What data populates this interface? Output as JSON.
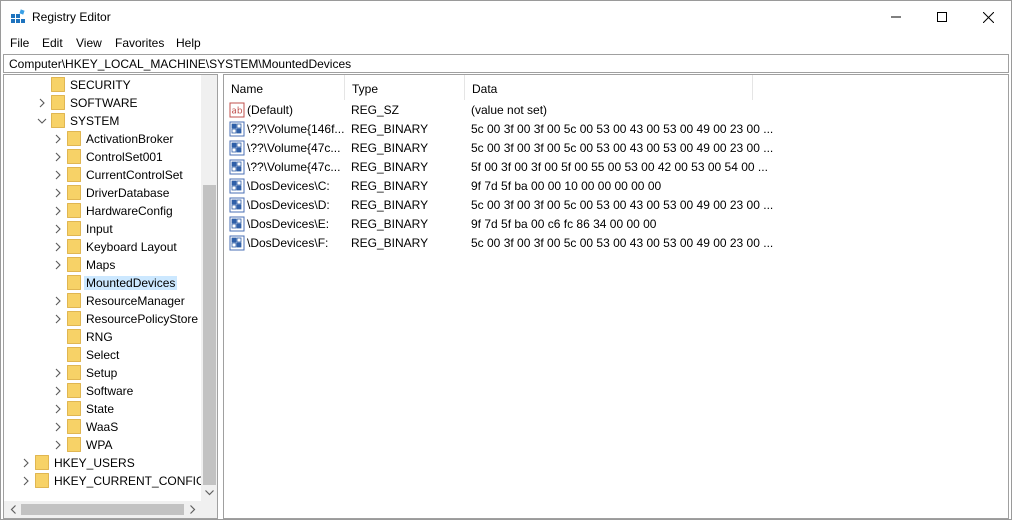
{
  "window": {
    "title": "Registry Editor",
    "controls": {
      "minimize": "minimize",
      "maximize": "maximize",
      "close": "close"
    }
  },
  "menu": [
    "File",
    "Edit",
    "View",
    "Favorites",
    "Help"
  ],
  "address": "Computer\\HKEY_LOCAL_MACHINE\\SYSTEM\\MountedDevices",
  "tree": [
    {
      "label": "SECURITY",
      "has_chevron": false,
      "chevron": "",
      "selected": false
    },
    {
      "label": "SOFTWARE",
      "has_chevron": true,
      "chevron": "right",
      "selected": false
    },
    {
      "label": "SYSTEM",
      "has_chevron": true,
      "chevron": "down",
      "selected": false
    },
    {
      "label": "ActivationBroker",
      "has_chevron": true,
      "chevron": "right",
      "selected": false
    },
    {
      "label": "ControlSet001",
      "has_chevron": true,
      "chevron": "right",
      "selected": false
    },
    {
      "label": "CurrentControlSet",
      "has_chevron": true,
      "chevron": "right",
      "selected": false
    },
    {
      "label": "DriverDatabase",
      "has_chevron": true,
      "chevron": "right",
      "selected": false
    },
    {
      "label": "HardwareConfig",
      "has_chevron": true,
      "chevron": "right",
      "selected": false
    },
    {
      "label": "Input",
      "has_chevron": true,
      "chevron": "right",
      "selected": false
    },
    {
      "label": "Keyboard Layout",
      "has_chevron": true,
      "chevron": "right",
      "selected": false
    },
    {
      "label": "Maps",
      "has_chevron": true,
      "chevron": "right",
      "selected": false
    },
    {
      "label": "MountedDevices",
      "has_chevron": false,
      "chevron": "",
      "selected": true
    },
    {
      "label": "ResourceManager",
      "has_chevron": true,
      "chevron": "right",
      "selected": false
    },
    {
      "label": "ResourcePolicyStore",
      "has_chevron": true,
      "chevron": "right",
      "selected": false
    },
    {
      "label": "RNG",
      "has_chevron": false,
      "chevron": "",
      "selected": false
    },
    {
      "label": "Select",
      "has_chevron": false,
      "chevron": "",
      "selected": false
    },
    {
      "label": "Setup",
      "has_chevron": true,
      "chevron": "right",
      "selected": false
    },
    {
      "label": "Software",
      "has_chevron": true,
      "chevron": "right",
      "selected": false
    },
    {
      "label": "State",
      "has_chevron": true,
      "chevron": "right",
      "selected": false
    },
    {
      "label": "WaaS",
      "has_chevron": true,
      "chevron": "right",
      "selected": false
    },
    {
      "label": "WPA",
      "has_chevron": true,
      "chevron": "right",
      "selected": false
    },
    {
      "label": "HKEY_USERS",
      "has_chevron": true,
      "chevron": "right",
      "selected": false
    },
    {
      "label": "HKEY_CURRENT_CONFIG",
      "has_chevron": true,
      "chevron": "right",
      "selected": false
    }
  ],
  "columns": [
    "Name",
    "Type",
    "Data"
  ],
  "values": [
    {
      "icon": "string-value-icon",
      "name": "(Default)",
      "type": "REG_SZ",
      "data": "(value not set)"
    },
    {
      "icon": "binary-value-icon",
      "name": "\\??\\Volume{146f...",
      "type": "REG_BINARY",
      "data": "5c 00 3f 00 3f 00 5c 00 53 00 43 00 53 00 49 00 23 00 ..."
    },
    {
      "icon": "binary-value-icon",
      "name": "\\??\\Volume{47c...",
      "type": "REG_BINARY",
      "data": "5c 00 3f 00 3f 00 5c 00 53 00 43 00 53 00 49 00 23 00 ..."
    },
    {
      "icon": "binary-value-icon",
      "name": "\\??\\Volume{47c...",
      "type": "REG_BINARY",
      "data": "5f 00 3f 00 3f 00 5f 00 55 00 53 00 42 00 53 00 54 00 ..."
    },
    {
      "icon": "binary-value-icon",
      "name": "\\DosDevices\\C:",
      "type": "REG_BINARY",
      "data": "9f 7d 5f ba 00 00 10 00 00 00 00 00"
    },
    {
      "icon": "binary-value-icon",
      "name": "\\DosDevices\\D:",
      "type": "REG_BINARY",
      "data": "5c 00 3f 00 3f 00 5c 00 53 00 43 00 53 00 49 00 23 00 ..."
    },
    {
      "icon": "binary-value-icon",
      "name": "\\DosDevices\\E:",
      "type": "REG_BINARY",
      "data": "9f 7d 5f ba 00 c6 fc 86 34 00 00 00"
    },
    {
      "icon": "binary-value-icon",
      "name": "\\DosDevices\\F:",
      "type": "REG_BINARY",
      "data": "5c 00 3f 00 3f 00 5c 00 53 00 43 00 53 00 49 00 23 00 ..."
    }
  ],
  "colors": {
    "selection": "#cce8ff",
    "folder": "#f7d267",
    "border": "#a0a0a0"
  }
}
